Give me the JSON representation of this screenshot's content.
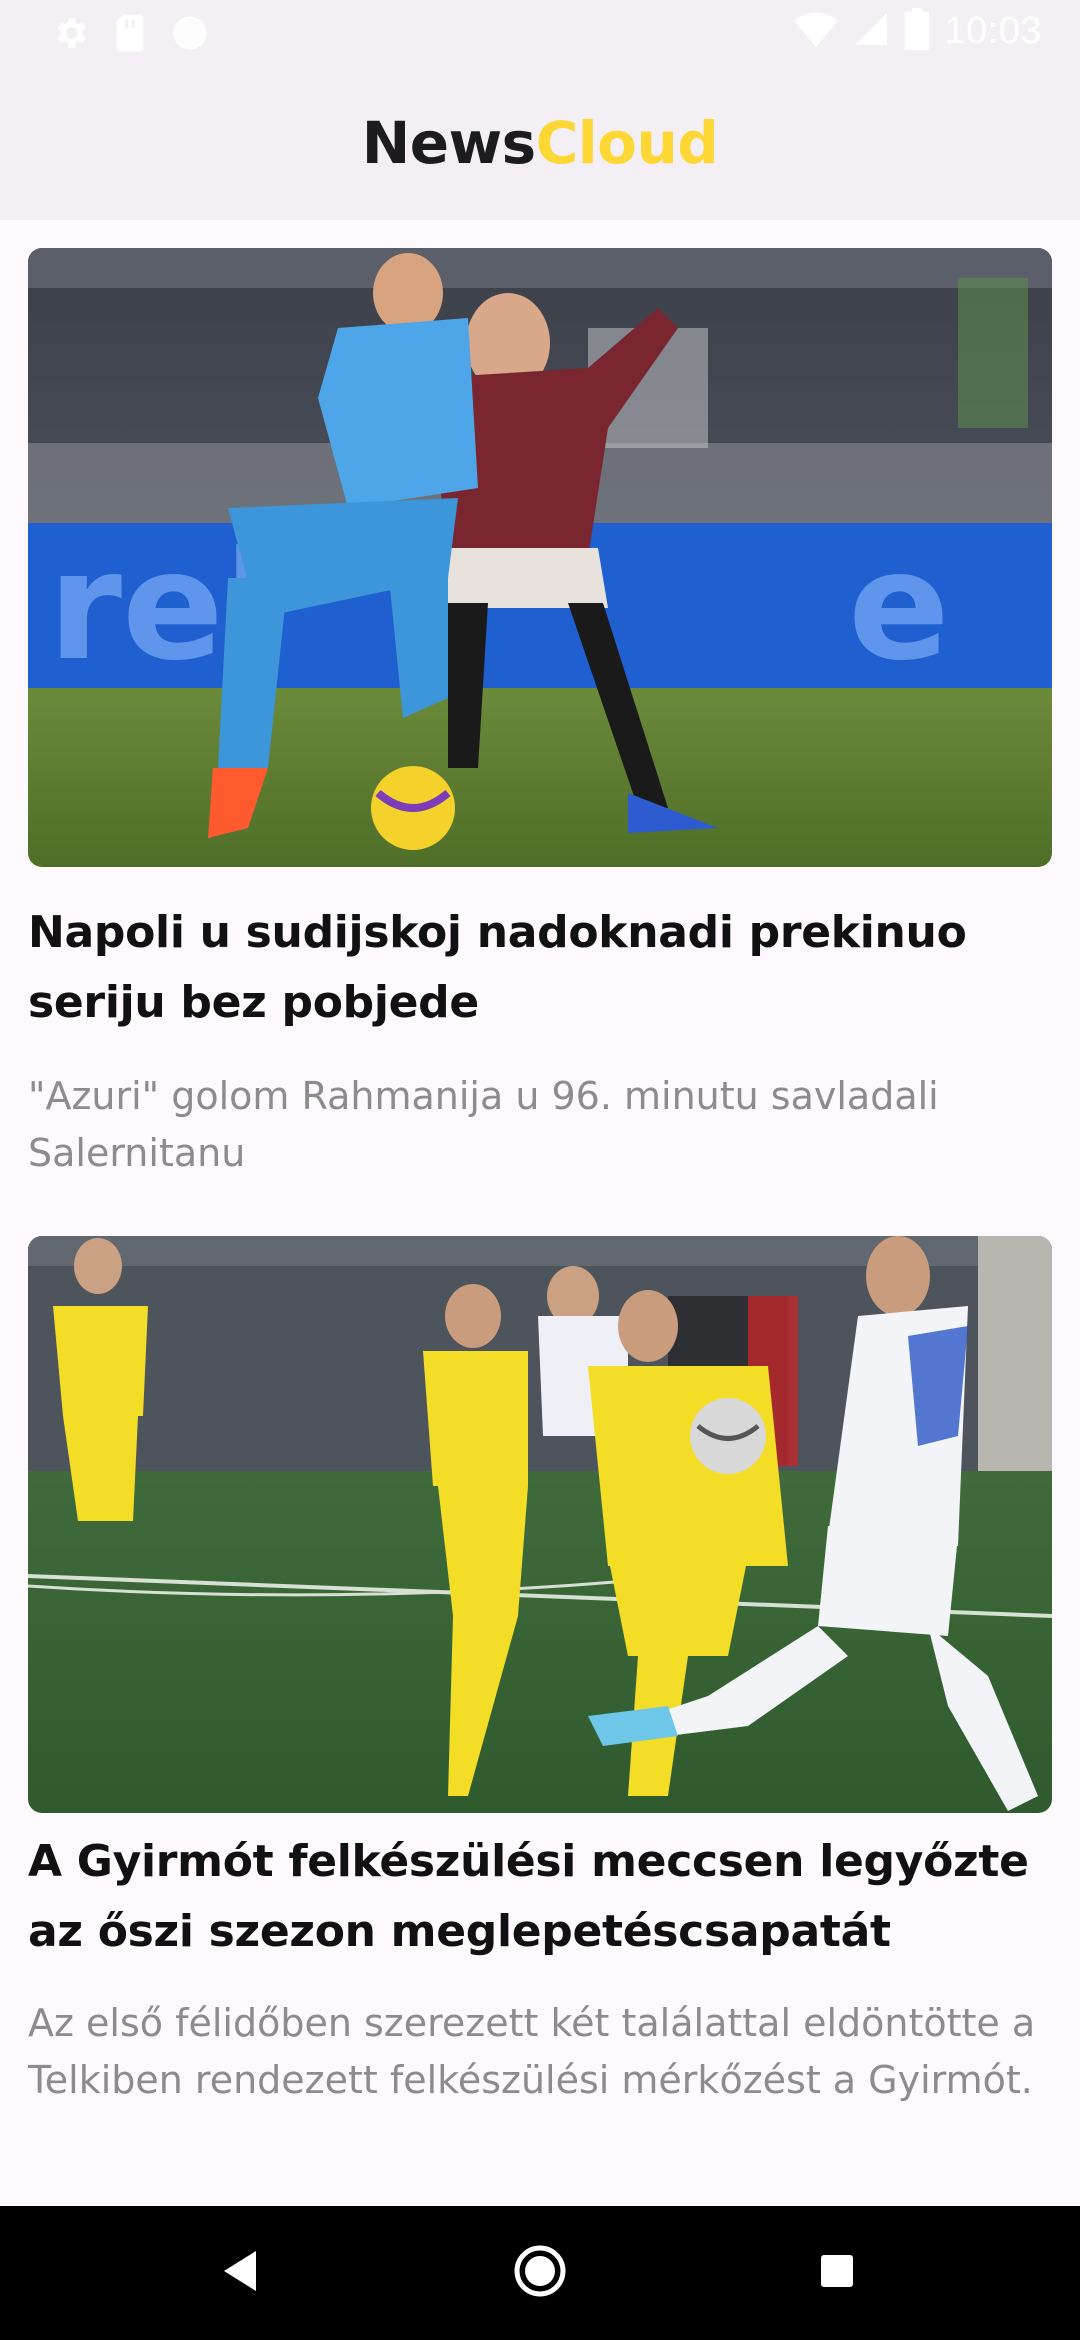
{
  "status_bar": {
    "time": "10:03",
    "left_icons": [
      "gear-icon",
      "sd-card-icon",
      "circle-icon"
    ],
    "right_icons": [
      "wifi-icon",
      "signal-icon",
      "battery-icon"
    ]
  },
  "app_bar": {
    "title_part1": "News",
    "title_part2": "Cloud",
    "title_part2_color": "#fdd835"
  },
  "articles": [
    {
      "title": "Napoli u sudijskoj nadoknadi prekinuo seriju bez pobjede",
      "summary": "\"Azuri\" golom Rahmanija u 96. minutu savladali Salernitanu",
      "image": "photo of two football players, Napoli (light blue) vs Torino (maroon), fighting for the ball"
    },
    {
      "title": "A Gyirmót felkészülési meccsen legyőzte az őszi szezon meglepetéscsapatát",
      "summary": "Az első félidőben szerezett két találattal eldöntötte a Telkiben rendezett felkészülési mérkőzést a Gyirmót.",
      "image": "photo of football players in yellow kits and a player in white-blue kit on a green pitch"
    }
  ],
  "nav_bar": {
    "buttons": [
      "back-icon",
      "home-icon",
      "recents-icon"
    ]
  },
  "colors": {
    "background": "#fdf9fd",
    "bar_background": "#f3eff4",
    "accent": "#fdd835",
    "title_text": "#111111",
    "summary_text": "#8d8a90"
  }
}
